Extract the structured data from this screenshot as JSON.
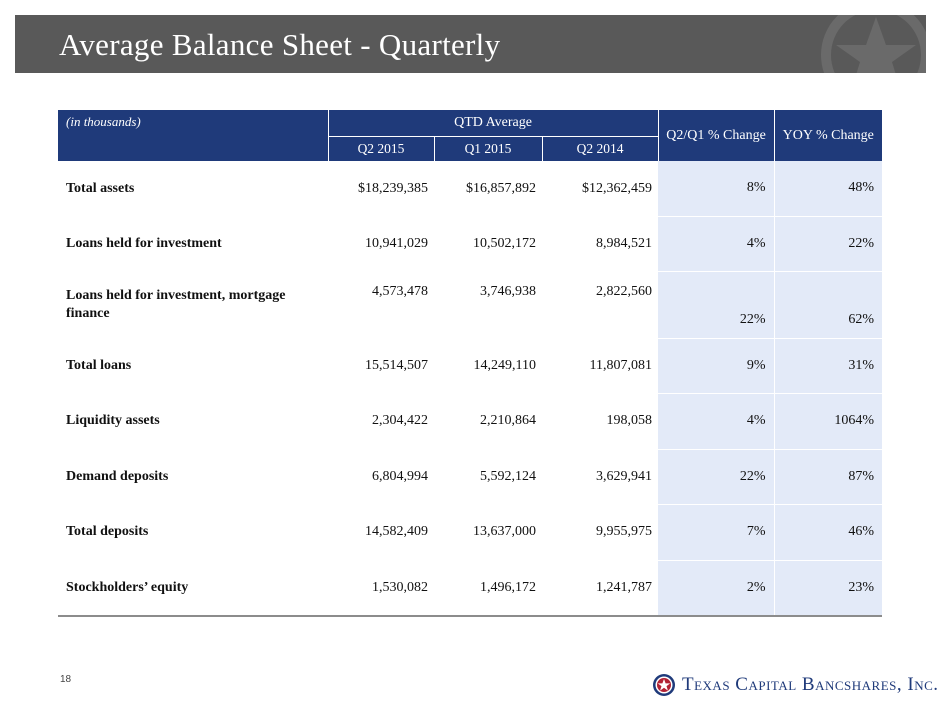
{
  "header": {
    "title": "Average Balance Sheet - Quarterly"
  },
  "table": {
    "corner_label": "(in thousands)",
    "group_header": "QTD Average",
    "sub_headers": [
      "Q2 2015",
      "Q1 2015",
      "Q2 2014"
    ],
    "change_headers": [
      "Q2/Q1 % Change",
      "YOY % Change"
    ],
    "rows": [
      {
        "label": "Total assets",
        "values": [
          "$18,239,385",
          "$16,857,892",
          "$12,362,459"
        ],
        "q_change": "8%",
        "yoy_change": "48%"
      },
      {
        "label": "Loans held for investment",
        "values": [
          "10,941,029",
          "10,502,172",
          "8,984,521"
        ],
        "q_change": "4%",
        "yoy_change": "22%"
      },
      {
        "label": "Loans held for investment, mortgage finance",
        "values": [
          "4,573,478",
          "3,746,938",
          "2,822,560"
        ],
        "q_change": "22%",
        "yoy_change": "62%"
      },
      {
        "label": "Total loans",
        "values": [
          "15,514,507",
          "14,249,110",
          "11,807,081"
        ],
        "q_change": "9%",
        "yoy_change": "31%"
      },
      {
        "label": "Liquidity assets",
        "values": [
          "2,304,422",
          "2,210,864",
          "198,058"
        ],
        "q_change": "4%",
        "yoy_change": "1064%"
      },
      {
        "label": "Demand deposits",
        "values": [
          "6,804,994",
          "5,592,124",
          "3,629,941"
        ],
        "q_change": "22%",
        "yoy_change": "87%"
      },
      {
        "label": "Total deposits",
        "values": [
          "14,582,409",
          "13,637,000",
          "9,955,975"
        ],
        "q_change": "7%",
        "yoy_change": "46%"
      },
      {
        "label": "Stockholders’ equity",
        "values": [
          "1,530,082",
          "1,496,172",
          "1,241,787"
        ],
        "q_change": "2%",
        "yoy_change": "23%"
      }
    ]
  },
  "footer": {
    "page_number": "18",
    "logo_text": "Texas Capital Bancshares, Inc.",
    "logo_icon": "star-seal-icon"
  },
  "colors": {
    "header_bg": "#595959",
    "table_header_bg": "#1f3a7a",
    "change_col_bg": "#e3eaf8",
    "logo": "#1f3a7a",
    "logo_accent": "#b22234"
  }
}
